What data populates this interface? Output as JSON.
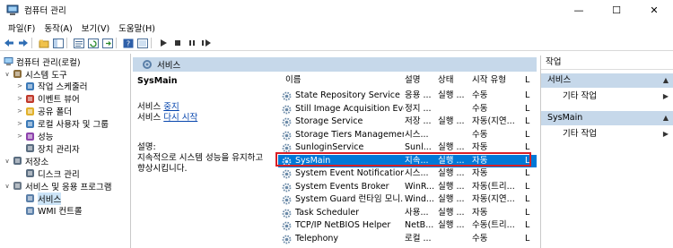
{
  "window": {
    "title": "컴퓨터 관리",
    "controls": [
      "—",
      "☐",
      "✕"
    ]
  },
  "menu": [
    "파일(F)",
    "동작(A)",
    "보기(V)",
    "도움말(H)"
  ],
  "tree": {
    "root": "컴퓨터 관리(로컬)",
    "items": [
      {
        "label": "시스템 도구",
        "icon": "tools-icon",
        "indent": 1,
        "expander": "∨"
      },
      {
        "label": "작업 스케줄러",
        "icon": "task-scheduler-icon",
        "indent": 2,
        "expander": ">"
      },
      {
        "label": "이벤트 뷰어",
        "icon": "event-viewer-icon",
        "indent": 2,
        "expander": ">"
      },
      {
        "label": "공유 폴더",
        "icon": "shared-folder-icon",
        "indent": 2,
        "expander": ">"
      },
      {
        "label": "로컬 사용자 및 그룹",
        "icon": "users-icon",
        "indent": 2,
        "expander": ">"
      },
      {
        "label": "성능",
        "icon": "performance-icon",
        "indent": 2,
        "expander": ">"
      },
      {
        "label": "장치 관리자",
        "icon": "device-manager-icon",
        "indent": 2,
        "expander": ""
      },
      {
        "label": "저장소",
        "icon": "storage-icon",
        "indent": 1,
        "expander": "∨"
      },
      {
        "label": "디스크 관리",
        "icon": "disk-icon",
        "indent": 2,
        "expander": ""
      },
      {
        "label": "서비스 및 응용 프로그램",
        "icon": "services-apps-icon",
        "indent": 1,
        "expander": "∨"
      },
      {
        "label": "서비스",
        "icon": "services-icon",
        "indent": 2,
        "expander": "",
        "selected": true
      },
      {
        "label": "WMI 컨트롤",
        "icon": "wmi-icon",
        "indent": 2,
        "expander": ""
      }
    ]
  },
  "middle": {
    "header": "서비스",
    "detail": {
      "service_name": "SysMain",
      "stop_prefix": "서비스 ",
      "stop_link": "중지",
      "restart_prefix": "서비스 ",
      "restart_link": "다시 시작",
      "desc_label": "설명:",
      "desc_line1": "지속적으로 시스템 성능을 유지하고",
      "desc_line2": "향상시킵니다."
    },
    "columns": [
      "이름",
      "설명",
      "상태",
      "시작 유형",
      "L"
    ],
    "rows": [
      {
        "name": "State Repository Service",
        "desc": "응용 ...",
        "status": "실행 ...",
        "startup": "수동",
        "logon": "L"
      },
      {
        "name": "Still Image Acquisition Eve...",
        "desc": "정지 ...",
        "status": "",
        "startup": "수동",
        "logon": "L"
      },
      {
        "name": "Storage Service",
        "desc": "저장 ...",
        "status": "실행 ...",
        "startup": "자동(지연...",
        "logon": "L"
      },
      {
        "name": "Storage Tiers Management",
        "desc": "시스...",
        "status": "",
        "startup": "수동",
        "logon": "L"
      },
      {
        "name": "SunloginService",
        "desc": "Sunl...",
        "status": "실행 ...",
        "startup": "자동",
        "logon": "L"
      },
      {
        "name": "SysMain",
        "desc": "지속...",
        "status": "실행 ...",
        "startup": "자동",
        "logon": "L",
        "selected": true
      },
      {
        "name": "System Event Notification ...",
        "desc": "시스...",
        "status": "실행 ...",
        "startup": "자동",
        "logon": "L"
      },
      {
        "name": "System Events Broker",
        "desc": "WinR...",
        "status": "실행 ...",
        "startup": "자동(트리...",
        "logon": "L"
      },
      {
        "name": "System Guard 런타임 모니...",
        "desc": "Wind...",
        "status": "실행 ...",
        "startup": "자동(지연...",
        "logon": "L"
      },
      {
        "name": "Task Scheduler",
        "desc": "사용...",
        "status": "실행 ...",
        "startup": "자동",
        "logon": "L"
      },
      {
        "name": "TCP/IP NetBIOS Helper",
        "desc": "NetB...",
        "status": "실행 ...",
        "startup": "수동(트리...",
        "logon": "L"
      },
      {
        "name": "Telephony",
        "desc": "로컬 ...",
        "status": "",
        "startup": "수동",
        "logon": "L"
      }
    ]
  },
  "actions": {
    "title": "작업",
    "sections": [
      {
        "header": "서비스",
        "item": "기타 작업"
      },
      {
        "header": "SysMain",
        "item": "기타 작업"
      }
    ]
  },
  "colors": {
    "header_bg": "#c6d8ea",
    "selection": "#0078d7",
    "highlight_border": "#d81f26"
  }
}
